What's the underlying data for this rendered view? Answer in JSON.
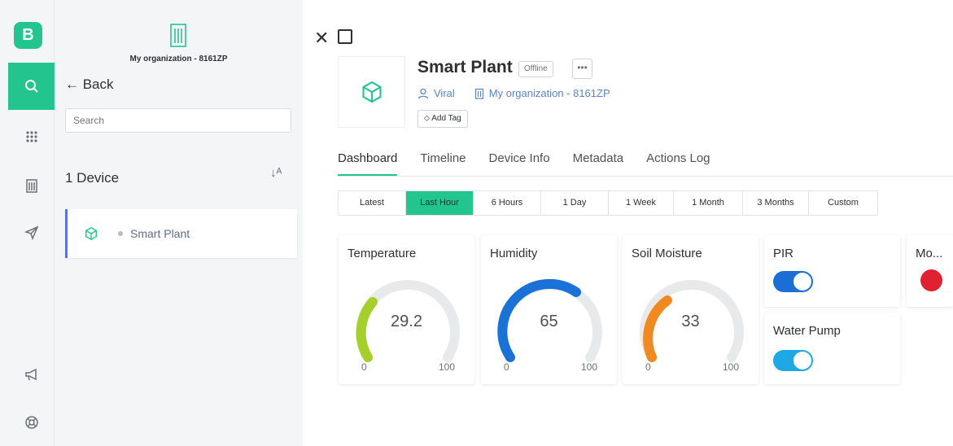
{
  "rail": {
    "logo": "B",
    "items": [
      {
        "icon": "search-icon"
      },
      {
        "icon": "apps-grid-icon"
      },
      {
        "icon": "organization-icon"
      },
      {
        "icon": "send-icon"
      },
      {
        "icon": "megaphone-icon"
      },
      {
        "icon": "help-lifebuoy-icon"
      }
    ]
  },
  "sidebar": {
    "org_name": "My organization - 8161ZP",
    "back_label": "← Back",
    "search_placeholder": "Search",
    "device_count": "1 Device",
    "sort_icon": "↓ᴬ",
    "devices": [
      {
        "name": "Smart Plant",
        "status": "offline"
      }
    ]
  },
  "device": {
    "name": "Smart Plant",
    "status_badge": "Offline",
    "more_label": "•••",
    "owner": "Viral",
    "organization": "My organization - 8161ZP",
    "add_tag_label": "Add Tag"
  },
  "tabs": [
    "Dashboard",
    "Timeline",
    "Device Info",
    "Metadata",
    "Actions Log"
  ],
  "active_tab": "Dashboard",
  "time_ranges": [
    "Latest",
    "Last Hour",
    "6 Hours",
    "1 Day",
    "1 Week",
    "1 Month",
    "3 Months",
    "Custom"
  ],
  "active_range": "Last Hour",
  "widgets": {
    "temperature": {
      "title": "Temperature",
      "value": "29.2",
      "min": "0",
      "max": "100",
      "color": "#a5cf2a"
    },
    "humidity": {
      "title": "Humidity",
      "value": "65",
      "min": "0",
      "max": "100",
      "color": "#1b72d6"
    },
    "soil": {
      "title": "Soil Moisture",
      "value": "33",
      "min": "0",
      "max": "100",
      "color": "#f0891f"
    },
    "pir": {
      "title": "PIR",
      "state": "on",
      "color": "#1b6fd4"
    },
    "pump": {
      "title": "Water Pump",
      "state": "on",
      "color": "#1ea8e6"
    },
    "motion": {
      "title": "Mo...",
      "led_color": "#e0212f"
    }
  },
  "colors": {
    "accent": "#23c48e",
    "gauge_track": "#e8e9eb"
  }
}
